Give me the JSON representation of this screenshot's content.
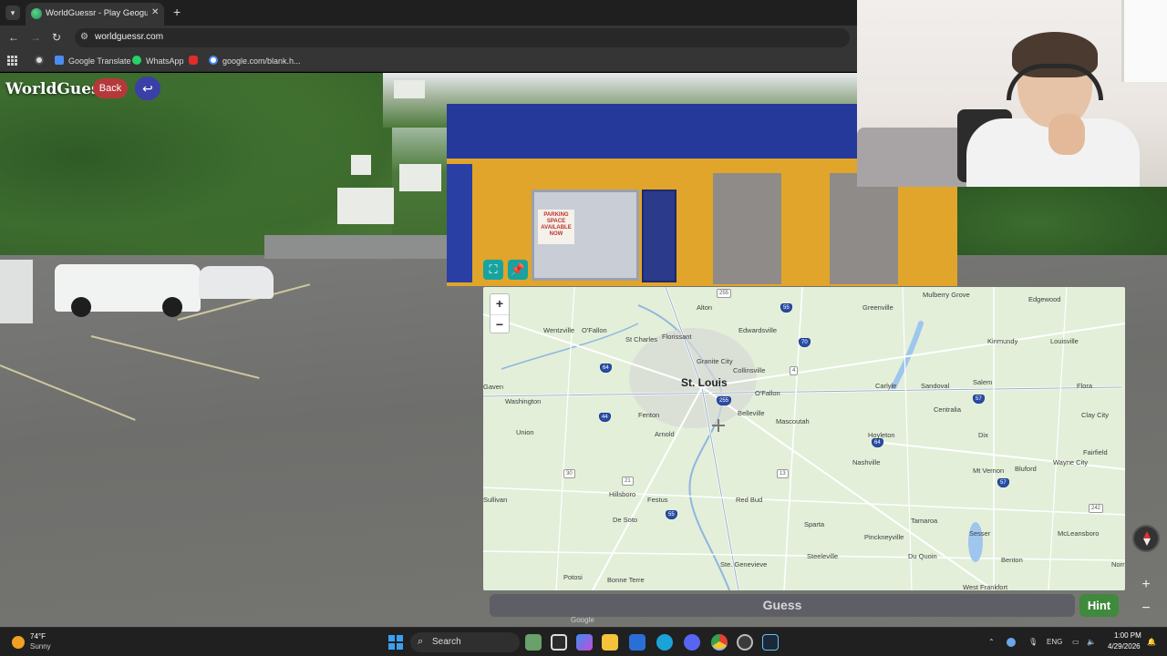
{
  "browser": {
    "tab_title": "WorldGuessr - Play Geoguessr Free",
    "url": "worldguessr.com",
    "bookmarks": [
      {
        "label": "Google Translate",
        "color": "#4a8cf0"
      },
      {
        "label": "WhatsApp",
        "color": "#25d366"
      },
      {
        "label": "",
        "color": "#e22c2c"
      },
      {
        "label": "google.com/blank.h...",
        "color": "#dddddd"
      }
    ]
  },
  "game": {
    "logo": "WorldGuessr",
    "back_label": "Back",
    "guess_label": "Guess",
    "hint_label": "Hint",
    "sign_text": "PARKING SPACE AVAILABLE NOW"
  },
  "map": {
    "attribution": "Google",
    "zoom_in": "+",
    "zoom_out": "−",
    "major_city": "St. Louis",
    "places": [
      "Alton",
      "Wentzville",
      "O'Fallon",
      "St Charles",
      "Florissant",
      "Edwardsville",
      "Granite City",
      "Collinsville",
      "Washington",
      "Fenton",
      "Arnold",
      "Belleville",
      "O'Fallon",
      "Mascoutah",
      "Union",
      "Hillsboro",
      "Festus",
      "Red Bud",
      "De Soto",
      "Sparta",
      "Pinckneyville",
      "Steeleville",
      "Ste. Genevieve",
      "Potosi",
      "Bonne Terre",
      "Sullivan",
      "Greenville",
      "Mulberry Grove",
      "Edgewood",
      "Kinmundy",
      "Louisville",
      "Carlyle",
      "Sandoval",
      "Salem",
      "Centralia",
      "Flora",
      "Clay City",
      "Hoyleton",
      "Nashville",
      "Dix",
      "Mt Vernon",
      "Bluford",
      "Wayne City",
      "Fairfield",
      "Tamaroa",
      "Du Quoin",
      "Sesser",
      "Benton",
      "McLeansboro",
      "West Frankfort",
      "Norris",
      "Gaven"
    ]
  },
  "webcam_alt": "",
  "taskbar": {
    "weather_temp": "74°F",
    "weather_desc": "Sunny",
    "search_label": "Search",
    "lang": "ENG",
    "time": "1:00 PM",
    "date": "4/29/2026"
  },
  "colors": {
    "back_button": "#b5393b",
    "return_button": "#3b3fa8",
    "map_tools": "#17a3a0",
    "hint_button": "#3f8a3c",
    "guess_button": "#5e5f66",
    "map_land": "#e3efd9"
  },
  "icons": {
    "tab_search": "chevron-down-icon",
    "favicon": "worldguessr-globe-icon",
    "back_nav": "arrow-left-icon",
    "forward_nav": "arrow-right-icon",
    "reload": "reload-icon",
    "return": "return-arrow-icon",
    "fullscreen": "fullscreen-icon",
    "pin": "pin-icon",
    "compass": "compass-icon"
  }
}
